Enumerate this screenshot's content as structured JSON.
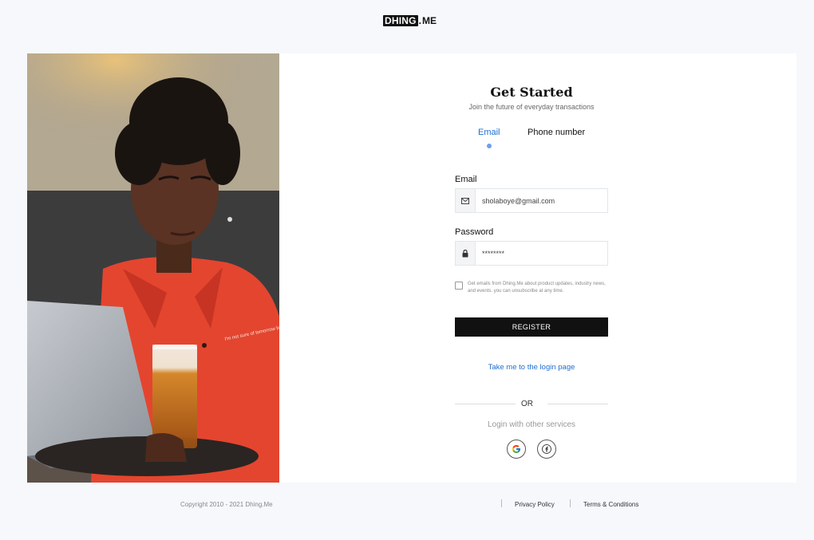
{
  "brand": {
    "logo_box_text": "DHING",
    "logo_dot": ".",
    "logo_suffix": "ME"
  },
  "hero_image": {
    "shirt_print_text": "I'm not sure of tomorrow but I'm sure of right now"
  },
  "form": {
    "title": "Get Started",
    "subtitle": "Join the future of everyday transactions",
    "tabs": [
      {
        "label": "Email",
        "active": true
      },
      {
        "label": "Phone number",
        "active": false
      }
    ],
    "email_label": "Email",
    "email_value": "sholaboye@gmail.com",
    "password_label": "Password",
    "password_value": "********",
    "consent_text": "Get emails from Dhing.Me about product updates, industry news, and events. you can unsubscribe at any time.",
    "register_label": "REGISTER",
    "login_link": "Take me to the login page",
    "or_text": "OR",
    "other_services": "Login with other services",
    "icons": {
      "email": "envelope-icon",
      "password": "lock-icon",
      "google": "google-icon",
      "facebook": "facebook-icon"
    }
  },
  "footer": {
    "copyright": "Copyright 2010 - 2021 Dhing.Me",
    "privacy": "Privacy Policy",
    "terms": "Terms & Conditions"
  },
  "colors": {
    "accent_blue": "#1f6ed0",
    "tab_dot": "#6e9ef0",
    "button_bg": "#111111",
    "page_bg": "#f6f8fc"
  }
}
